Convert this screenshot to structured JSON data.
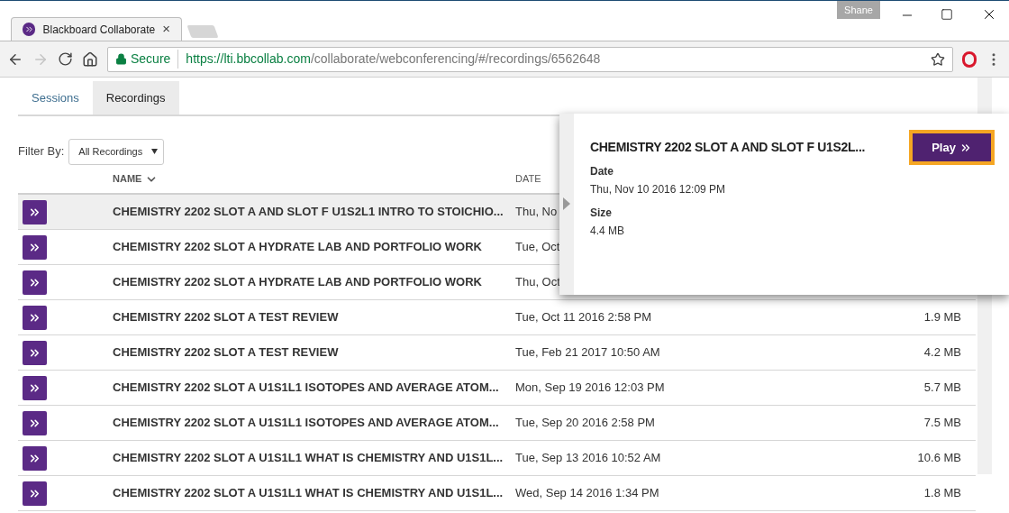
{
  "browser": {
    "tab": {
      "title": "Blackboard Collaborate",
      "close": "×"
    },
    "profile": "Shane",
    "address": {
      "secure_label": "Secure",
      "host": "https://lti.bbcollab.com",
      "path": "/collaborate/webconferencing/#/recordings/6562648"
    }
  },
  "tabs": [
    {
      "label": "Sessions",
      "selected": false
    },
    {
      "label": "Recordings",
      "selected": true
    }
  ],
  "filter": {
    "label": "Filter By:",
    "value": "All Recordings"
  },
  "table": {
    "columns": [
      "NAME",
      "DATE"
    ],
    "rows": [
      {
        "name": "CHEMISTRY 2202 SLOT A AND SLOT F U1S2L1 INTRO TO STOICHIO...",
        "date": "Thu, No",
        "selected": true
      },
      {
        "name": "CHEMISTRY 2202 SLOT A HYDRATE LAB AND PORTFOLIO WORK",
        "date": "Tue, Oct",
        "selected": false
      },
      {
        "name": "CHEMISTRY 2202 SLOT A HYDRATE LAB AND PORTFOLIO WORK",
        "date": "Thu, Oct",
        "selected": false
      },
      {
        "name": "CHEMISTRY 2202 SLOT A TEST REVIEW",
        "date": "Tue, Oct 11 2016 2:58 PM",
        "size": "1.9 MB",
        "selected": false
      },
      {
        "name": "CHEMISTRY 2202 SLOT A TEST REVIEW",
        "date": "Tue, Feb 21 2017 10:50 AM",
        "size": "4.2 MB",
        "selected": false
      },
      {
        "name": "CHEMISTRY 2202 SLOT A U1S1L1 ISOTOPES AND AVERAGE ATOM...",
        "date": "Mon, Sep 19 2016 12:03 PM",
        "size": "5.7 MB",
        "selected": false
      },
      {
        "name": "CHEMISTRY 2202 SLOT A U1S1L1 ISOTOPES AND AVERAGE ATOM...",
        "date": "Tue, Sep 20 2016 2:58 PM",
        "size": "7.5 MB",
        "selected": false
      },
      {
        "name": "CHEMISTRY 2202 SLOT A U1S1L1 WHAT IS CHEMISTRY AND U1S1L...",
        "date": "Tue, Sep 13 2016 10:52 AM",
        "size": "10.6 MB",
        "selected": false
      },
      {
        "name": "CHEMISTRY 2202 SLOT A U1S1L1 WHAT IS CHEMISTRY AND U1S1L...",
        "date": "Wed, Sep 14 2016 1:34 PM",
        "size": "1.8 MB",
        "selected": false
      }
    ]
  },
  "popover": {
    "title": "CHEMISTRY 2202 SLOT A AND SLOT F U1S2L...",
    "play": "Play",
    "fields": [
      {
        "label": "Date",
        "value": "Thu, Nov 10 2016 12:09 PM"
      },
      {
        "label": "Size",
        "value": "4.4 MB"
      }
    ]
  }
}
